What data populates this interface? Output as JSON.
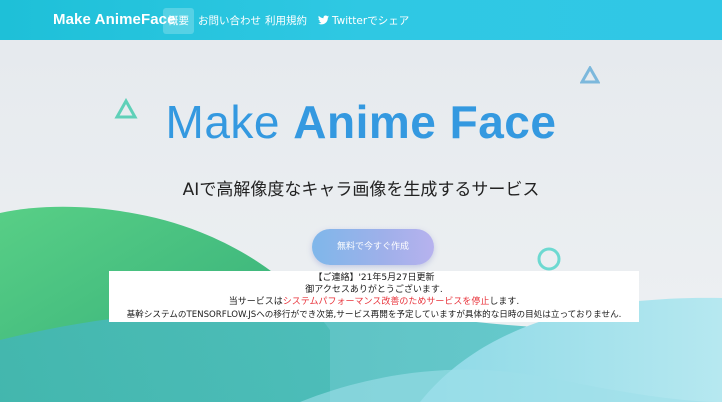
{
  "nav": {
    "brand": "Make AnimeFace",
    "items": [
      {
        "label": "概要",
        "active": true
      },
      {
        "label": "お問い合わせ"
      },
      {
        "label": "利用規約"
      },
      {
        "label": "Twitterでシェア",
        "icon": "twitter-icon"
      }
    ]
  },
  "hero": {
    "title_light": "Make ",
    "title_bold": "Anime Face",
    "subtitle": "AIで高解像度なキャラ画像を生成するサービス",
    "cta_label": "無料で今すぐ作成"
  },
  "notice": {
    "line1": "【ご連絡】'21年5月27日更新",
    "line2": "御アクセスありがとうございます.",
    "line3_pre": "当サービスは",
    "line3_red": "システムパフォーマンス改善のためサービスを停止",
    "line3_post": "します.",
    "line4": "基幹システムのTENSORFLOW.JSへの移行ができ次第,サービス再開を予定していますが具体的な日時の目処は立っておりません."
  },
  "colors": {
    "nav_gradient_start": "#1ec0d8",
    "nav_gradient_end": "#30c7e6",
    "title": "#3499e0",
    "notice_red": "#e8323a"
  }
}
